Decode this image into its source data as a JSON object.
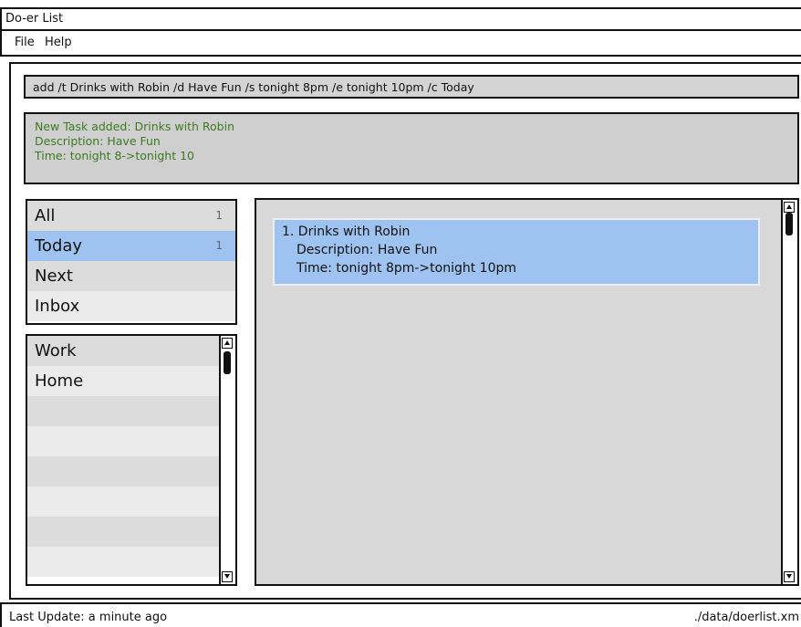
{
  "window": {
    "title": "Do-er List"
  },
  "menu": {
    "file": "File",
    "help": "Help"
  },
  "command": {
    "text": "add /t Drinks with Robin /d Have Fun /s tonight 8pm /e tonight 10pm /c Today"
  },
  "feedback": {
    "line1": "New Task added: Drinks with Robin",
    "line2": "Description: Have Fun",
    "line3": "Time: tonight 8->tonight 10",
    "color": "#3d7a22"
  },
  "categories": [
    {
      "label": "All",
      "count": "1"
    },
    {
      "label": "Today",
      "count": "1",
      "selected": true
    },
    {
      "label": "Next",
      "count": ""
    },
    {
      "label": "Inbox",
      "count": ""
    }
  ],
  "tags": [
    {
      "label": "Work"
    },
    {
      "label": "Home"
    }
  ],
  "tasks": [
    {
      "title": "1. Drinks with Robin",
      "description": "Description: Have Fun",
      "time": "Time: tonight 8pm->tonight 10pm"
    }
  ],
  "status": {
    "last_update": "Last Update: a minute ago",
    "file_path": "./data/doerlist.xm"
  },
  "colors": {
    "selection": "#9ec3f0",
    "panel": "#d8d8d8"
  }
}
